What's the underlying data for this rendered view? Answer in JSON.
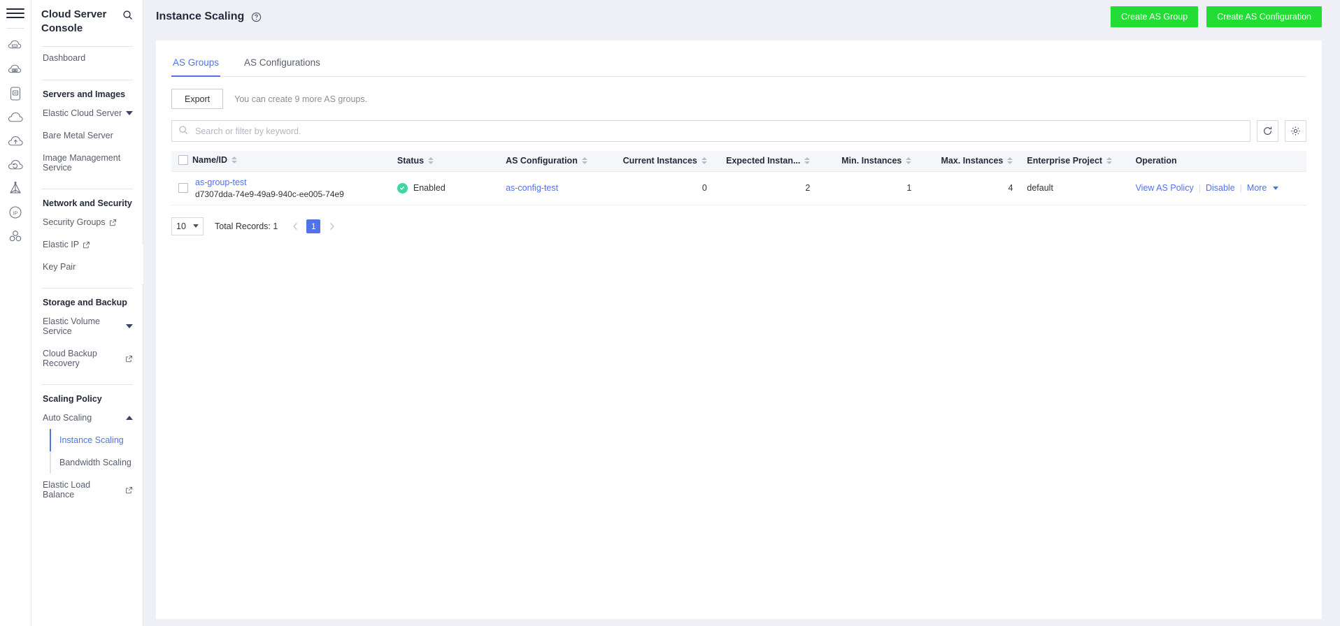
{
  "rail": {
    "menu_icon": "hamburger-icon",
    "icons": [
      {
        "name": "elastic-cloud-server-icon"
      },
      {
        "name": "bare-metal-server-icon"
      },
      {
        "name": "image-management-icon"
      },
      {
        "name": "cloud-icon"
      },
      {
        "name": "cloud-upload-icon"
      },
      {
        "name": "cloud-backup-icon"
      },
      {
        "name": "auto-scaling-icon"
      },
      {
        "name": "elastic-ip-icon"
      },
      {
        "name": "load-balance-icon"
      }
    ]
  },
  "sidebar": {
    "title": "Cloud Server Console",
    "search_icon": "search-icon",
    "dashboard": "Dashboard",
    "groups": [
      {
        "title": "Servers and Images",
        "items": [
          {
            "label": "Elastic Cloud Server",
            "suffix": "caret-down"
          },
          {
            "label": "Bare Metal Server",
            "suffix": "none"
          },
          {
            "label": "Image Management Service",
            "suffix": "none"
          }
        ]
      },
      {
        "title": "Network and Security",
        "items": [
          {
            "label": "Security Groups",
            "suffix": "external"
          },
          {
            "label": "Elastic IP",
            "suffix": "external"
          },
          {
            "label": "Key Pair",
            "suffix": "none"
          }
        ]
      },
      {
        "title": "Storage and Backup",
        "items": [
          {
            "label": "Elastic Volume Service",
            "suffix": "caret-down"
          },
          {
            "label": "Cloud Backup Recovery",
            "suffix": "external"
          }
        ]
      },
      {
        "title": "Scaling Policy",
        "items": [
          {
            "label": "Auto Scaling",
            "suffix": "caret-up"
          }
        ]
      }
    ],
    "sub_items": [
      {
        "label": "Instance Scaling",
        "active": true
      },
      {
        "label": "Bandwidth Scaling",
        "active": false
      }
    ],
    "last_item": {
      "label": "Elastic Load Balance",
      "suffix": "external"
    },
    "collapse_icon": "chevron-left-icon"
  },
  "header": {
    "title": "Instance Scaling",
    "help_icon": "help-circle-icon",
    "create_group_label": "Create AS Group",
    "create_config_label": "Create AS Configuration",
    "button_color": "#22dd33"
  },
  "tabs": [
    {
      "label": "AS Groups",
      "active": true
    },
    {
      "label": "AS Configurations",
      "active": false
    }
  ],
  "toolbar": {
    "export_label": "Export",
    "quota_tip": "You can create 9 more AS groups."
  },
  "search": {
    "placeholder": "Search or filter by keyword.",
    "value": "",
    "icon": "search-icon",
    "refresh_icon": "refresh-icon",
    "settings_icon": "gear-icon"
  },
  "table": {
    "columns": [
      {
        "label": "Name/ID",
        "sortable": true,
        "align": "left"
      },
      {
        "label": "Status",
        "sortable": true,
        "align": "left"
      },
      {
        "label": "AS Configuration",
        "sortable": true,
        "align": "left"
      },
      {
        "label": "Current Instances",
        "sortable": true,
        "align": "right"
      },
      {
        "label": "Expected Instan...",
        "sortable": true,
        "align": "right"
      },
      {
        "label": "Min. Instances",
        "sortable": true,
        "align": "right"
      },
      {
        "label": "Max. Instances",
        "sortable": true,
        "align": "right"
      },
      {
        "label": "Enterprise Project",
        "sortable": true,
        "align": "left"
      },
      {
        "label": "Operation",
        "sortable": false,
        "align": "left"
      }
    ],
    "rows": [
      {
        "name": "as-group-test",
        "id": "d7307dda-74e9-49a9-940c-ee005-74e9",
        "status": "Enabled",
        "status_icon": "check-circle-icon",
        "as_configuration": "as-config-test",
        "current_instances": "0",
        "expected_instances": "2",
        "min_instances": "1",
        "max_instances": "4",
        "enterprise_project": "default",
        "operations": [
          "View AS Policy",
          "Disable",
          "More"
        ]
      }
    ]
  },
  "pagination": {
    "page_size": "10",
    "total_records": "Total Records: 1",
    "prev_icon": "chevron-left-icon",
    "next_icon": "chevron-right-icon",
    "current_page": "1"
  }
}
